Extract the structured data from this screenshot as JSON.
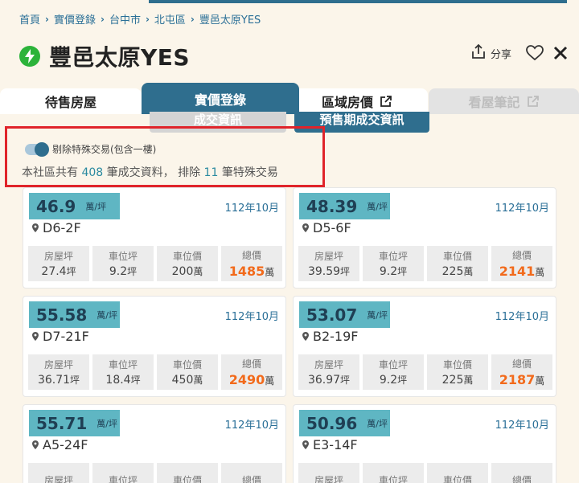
{
  "breadcrumb": [
    "首頁",
    "實價登錄",
    "台中市",
    "北屯區",
    "豐邑太原YES"
  ],
  "page_title": "豐邑太原YES",
  "actions": {
    "share_label": "分享"
  },
  "tabs": [
    {
      "label": "待售房屋"
    },
    {
      "label": "實價登錄"
    },
    {
      "label": "區域房價"
    },
    {
      "label": "看屋筆記"
    }
  ],
  "subtabs": [
    {
      "label": "成交資訊"
    },
    {
      "label": "預售期成交資訊"
    }
  ],
  "filter": {
    "toggle_label": "剔除特殊交易(包含一樓)",
    "toggle_on": true,
    "summary_prefix": "本社區共有",
    "total_count": "408",
    "summary_middle": "筆成交資料， 排除",
    "excluded_count": "11",
    "summary_suffix": "筆特殊交易"
  },
  "stat_labels": {
    "area": "房屋坪",
    "parking_area": "車位坪",
    "parking_price": "車位價",
    "total": "總價"
  },
  "units": {
    "price": "萬/坪",
    "ping": "坪",
    "wan": "萬"
  },
  "listings": [
    {
      "price": "46.9",
      "date": "112年10月",
      "floor": "D6-2F",
      "area": "27.4",
      "parking_area": "9.2",
      "parking_price": "200",
      "total": "1485"
    },
    {
      "price": "48.39",
      "date": "112年10月",
      "floor": "D5-6F",
      "area": "39.59",
      "parking_area": "9.2",
      "parking_price": "225",
      "total": "2141"
    },
    {
      "price": "55.58",
      "date": "112年10月",
      "floor": "D7-21F",
      "area": "36.71",
      "parking_area": "18.4",
      "parking_price": "450",
      "total": "2490"
    },
    {
      "price": "53.07",
      "date": "112年10月",
      "floor": "B2-19F",
      "area": "36.97",
      "parking_area": "9.2",
      "parking_price": "225",
      "total": "2187"
    },
    {
      "price": "55.71",
      "date": "112年10月",
      "floor": "A5-24F",
      "area": "",
      "parking_area": "",
      "parking_price": "",
      "total": ""
    },
    {
      "price": "50.96",
      "date": "112年10月",
      "floor": "E3-14F",
      "area": "",
      "parking_area": "",
      "parking_price": "",
      "total": ""
    }
  ],
  "colors": {
    "accent": "#2f6e8e",
    "badge": "#5fb6c3",
    "total": "#f26a1b",
    "highlight_border": "#e0242b",
    "bolt": "#2cb33a"
  }
}
